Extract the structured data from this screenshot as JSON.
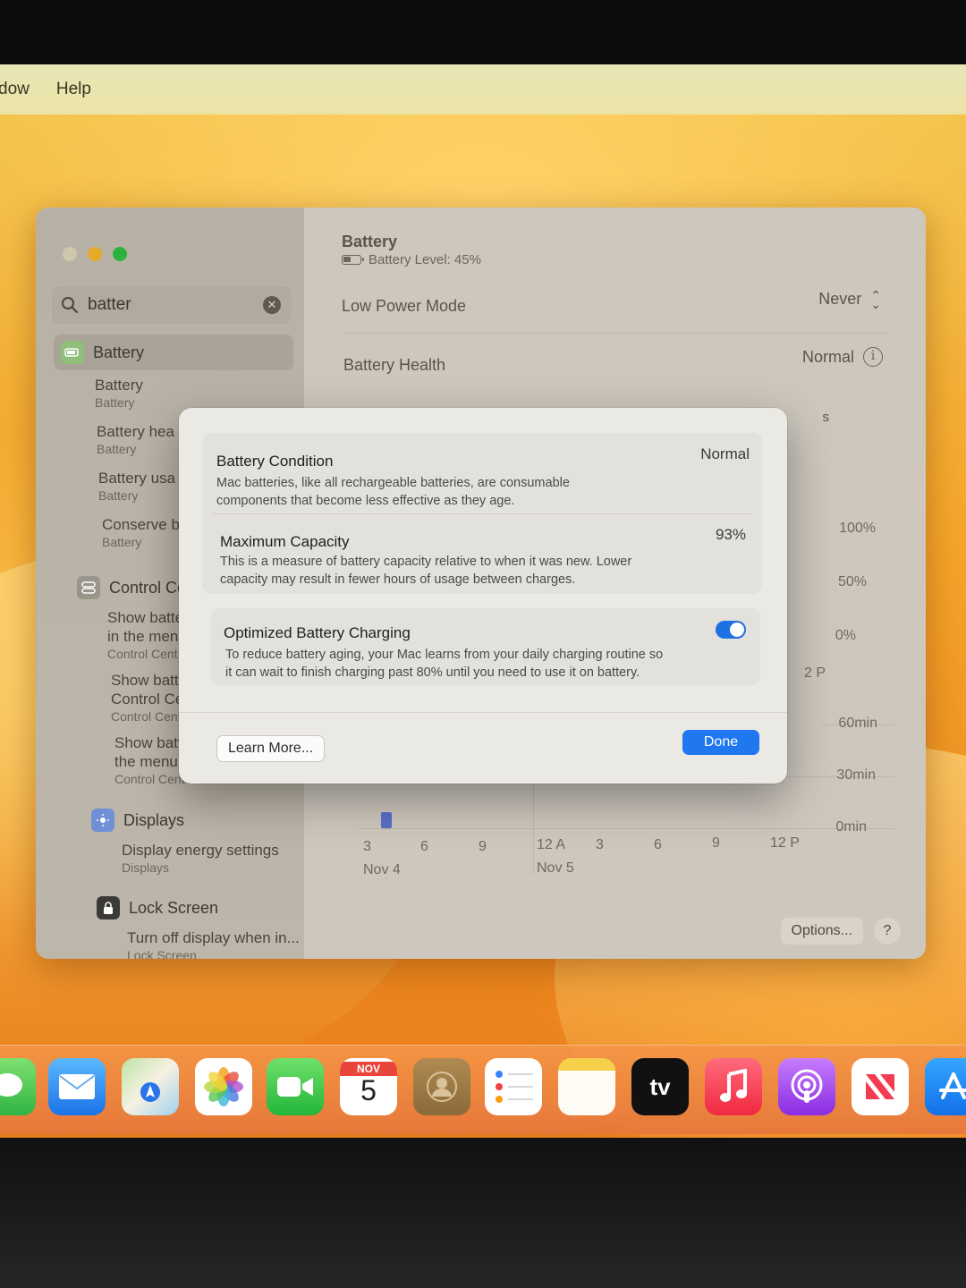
{
  "menubar": {
    "items": [
      "dow",
      "Help"
    ]
  },
  "sidebar": {
    "search": {
      "value": "batter",
      "placeholder": "Search"
    },
    "selected": "Battery",
    "results": [
      {
        "title": "Battery",
        "subtitle": "Battery"
      },
      {
        "title": "Battery hea",
        "subtitle": "Battery"
      },
      {
        "title": "Battery usa",
        "subtitle": "Battery"
      },
      {
        "title": "Conserve b",
        "subtitle": "Battery"
      }
    ],
    "control_center": {
      "label": "Control Ce",
      "results": [
        {
          "title_lines": [
            "Show batte",
            "in the menu"
          ],
          "subtitle": "Control Cent"
        },
        {
          "title_lines": [
            "Show batte",
            "Control Ce"
          ],
          "subtitle": "Control Cent"
        },
        {
          "title_lines": [
            "Show batte",
            "the menu b"
          ],
          "subtitle": "Control Cent"
        }
      ]
    },
    "displays": {
      "label": "Displays",
      "results": [
        {
          "title": "Display energy settings",
          "subtitle": "Displays"
        }
      ]
    },
    "lock_screen": {
      "label": "Lock Screen",
      "results": [
        {
          "title": "Turn off display when in...",
          "subtitle": "Lock Screen"
        }
      ]
    }
  },
  "main": {
    "title": "Battery",
    "battery_level": "Battery Level: 45%",
    "low_power_mode": {
      "label": "Low Power Mode",
      "value": "Never"
    },
    "battery_health": {
      "label": "Battery Health",
      "value": "Normal"
    },
    "partial_row_letter": "s",
    "chart_axis": {
      "level_ticks": [
        "100%",
        "50%",
        "0%"
      ],
      "level_x_partial": "2 P",
      "usage_ticks": [
        "60min",
        "30min",
        "0min"
      ],
      "x_ticks": [
        "3",
        "6",
        "9",
        "12 A",
        "3",
        "6",
        "9",
        "12 P"
      ],
      "dates": [
        "Nov 4",
        "Nov 5"
      ]
    },
    "options_label": "Options...",
    "help_label": "?"
  },
  "sheet": {
    "condition": {
      "title": "Battery Condition",
      "value": "Normal",
      "desc_line1": "Mac batteries, like all rechargeable batteries, are consumable",
      "desc_line2": "components that become less effective as they age."
    },
    "capacity": {
      "title": "Maximum Capacity",
      "value": "93%",
      "desc_line1": "This is a measure of battery capacity relative to when it was new. Lower",
      "desc_line2": "capacity may result in fewer hours of usage between charges."
    },
    "optimized": {
      "title": "Optimized Battery Charging",
      "enabled": true,
      "desc_line1": "To reduce battery aging, your Mac learns from your daily charging routine so",
      "desc_line2": "it can wait to finish charging past 80% until you need to use it on battery."
    },
    "learn_more": "Learn More...",
    "done": "Done"
  },
  "dock": {
    "apps": [
      "messages-icon",
      "mail-icon",
      "maps-icon",
      "photos-icon",
      "facetime-icon",
      "calendar-icon",
      "contacts-icon",
      "reminders-icon",
      "notes-icon",
      "tv-icon",
      "music-icon",
      "podcasts-icon",
      "news-icon",
      "app-store-icon"
    ],
    "calendar": {
      "month": "NOV",
      "day": "5"
    },
    "tv_label": "tv"
  },
  "colors": {
    "accent": "#1f78f0",
    "toggle_on": "#1f6fe5",
    "battery_green": "#34c759"
  }
}
